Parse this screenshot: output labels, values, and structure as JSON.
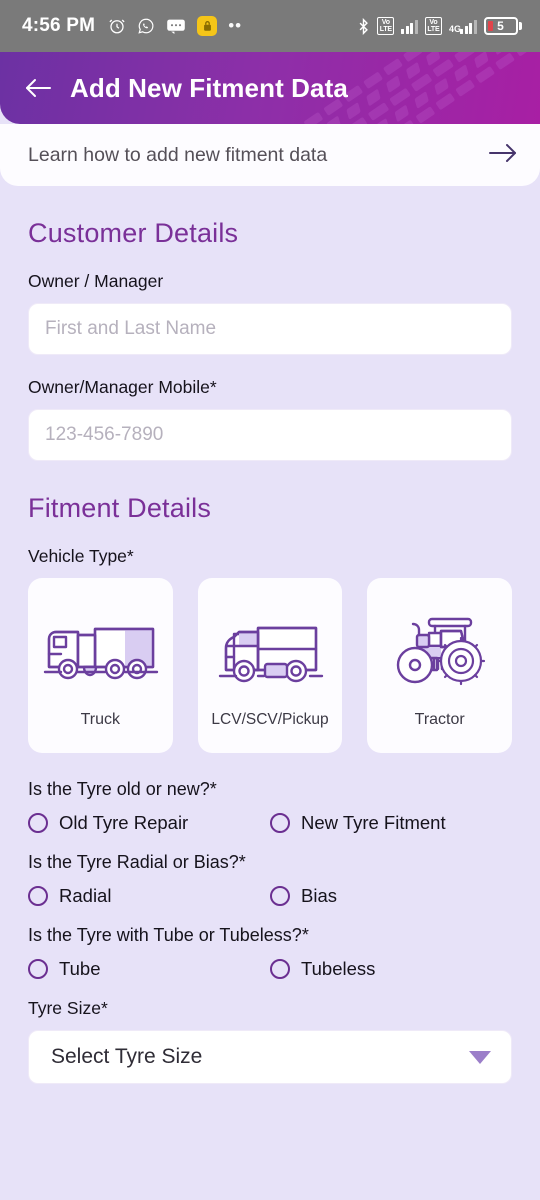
{
  "status_bar": {
    "time": "4:56 PM",
    "left_icons": [
      "alarm-clock-icon",
      "whatsapp-icon",
      "messages-icon",
      "app-badge-icon",
      "more-dots-icon"
    ],
    "right_icons": [
      "bluetooth-icon",
      "volte-1-icon",
      "signal-1-icon",
      "volte-2-icon",
      "4g-icon",
      "signal-2-icon"
    ],
    "volte_label": "VoLTE",
    "network_label": "4G",
    "battery_percent": "5"
  },
  "app_bar": {
    "title": "Add New Fitment Data",
    "back_icon": "back-arrow-icon"
  },
  "learn_banner": {
    "text": "Learn how to add new fitment data",
    "arrow_icon": "arrow-right-icon"
  },
  "customer_details": {
    "heading": "Customer Details",
    "owner_label": "Owner / Manager",
    "owner_placeholder": "First and Last Name",
    "owner_value": "",
    "mobile_label": "Owner/Manager Mobile*",
    "mobile_placeholder": "123-456-7890",
    "mobile_value": ""
  },
  "fitment_details": {
    "heading": "Fitment Details",
    "vehicle_type_label": "Vehicle Type*",
    "vehicle_types": [
      {
        "label": "Truck",
        "icon": "truck-icon",
        "selected": false
      },
      {
        "label": "LCV/SCV/Pickup",
        "icon": "lcv-pickup-icon",
        "selected": false
      },
      {
        "label": "Tractor",
        "icon": "tractor-icon",
        "selected": false
      }
    ],
    "radio_groups": [
      {
        "question": "Is the Tyre old or new?*",
        "options": [
          {
            "label": "Old Tyre Repair",
            "selected": false
          },
          {
            "label": "New Tyre Fitment",
            "selected": false
          }
        ]
      },
      {
        "question": "Is the Tyre Radial or Bias?*",
        "options": [
          {
            "label": "Radial",
            "selected": false
          },
          {
            "label": "Bias",
            "selected": false
          }
        ]
      },
      {
        "question": "Is the Tyre with Tube or Tubeless?*",
        "options": [
          {
            "label": "Tube",
            "selected": false
          },
          {
            "label": "Tubeless",
            "selected": false
          }
        ]
      }
    ],
    "tyre_size_label": "Tyre Size*",
    "tyre_size_value": "Select Tyre Size",
    "tyre_size_caret_icon": "chevron-down-icon"
  },
  "colors": {
    "brand_purple": "#7a3098",
    "app_bar_start": "#6c31a3",
    "app_bar_end": "#a81fa4",
    "page_background": "#e7e2f8",
    "radio_outline": "#6b2f91",
    "battery_low": "#e2444b"
  }
}
